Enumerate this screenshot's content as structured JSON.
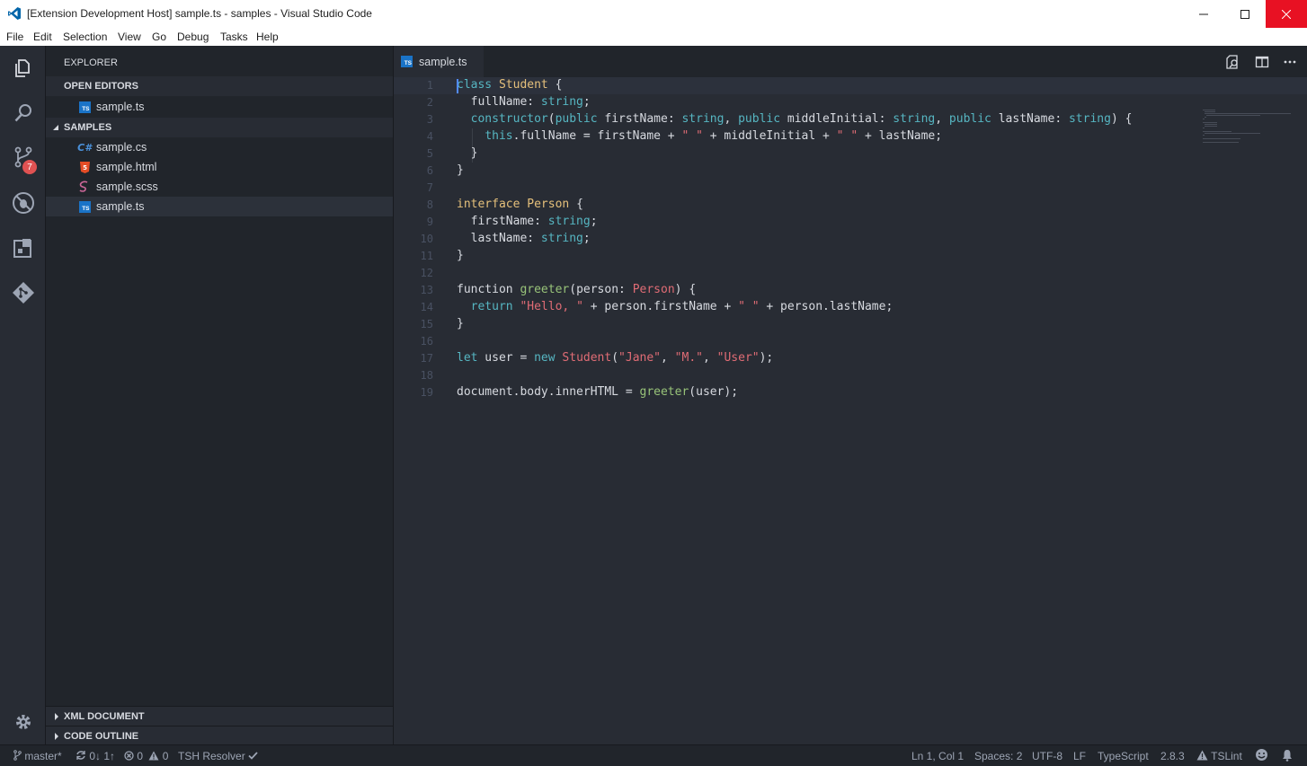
{
  "window": {
    "title": "[Extension Development Host] sample.ts - samples - Visual Studio Code",
    "controls": [
      "minimize",
      "maximize",
      "close"
    ]
  },
  "menu": [
    "File",
    "Edit",
    "Selection",
    "View",
    "Go",
    "Debug",
    "Tasks",
    "Help"
  ],
  "activity_bar": {
    "items": [
      "explorer-icon",
      "search-icon",
      "source-control-icon",
      "debug-icon",
      "extensions-icon",
      "git-icon"
    ],
    "scm_badge": "7",
    "bottom": "gear-icon"
  },
  "sidebar": {
    "title": "EXPLORER",
    "open_editors": {
      "header": "OPEN EDITORS",
      "files": [
        {
          "name": "sample.ts",
          "icon": "ts"
        }
      ]
    },
    "samples": {
      "header": "SAMPLES",
      "files": [
        {
          "name": "sample.cs",
          "icon": "csharp"
        },
        {
          "name": "sample.html",
          "icon": "html"
        },
        {
          "name": "sample.scss",
          "icon": "scss"
        },
        {
          "name": "sample.ts",
          "icon": "ts"
        }
      ]
    },
    "xml_document": "XML DOCUMENT",
    "code_outline": "CODE OUTLINE"
  },
  "editor": {
    "tab": "sample.ts",
    "line_numbers": [
      "1",
      "2",
      "3",
      "4",
      "5",
      "6",
      "7",
      "8",
      "9",
      "10",
      "11",
      "12",
      "13",
      "14",
      "15",
      "16",
      "17",
      "18",
      "19"
    ]
  },
  "status": {
    "branch": "master*",
    "sync": "0↓ 1↑",
    "errors": "0",
    "warnings": "0",
    "resolver": "TSH Resolver",
    "position": "Ln 1, Col 1",
    "spaces": "Spaces: 2",
    "encoding": "UTF-8",
    "eol": "LF",
    "language": "TypeScript",
    "version": "2.8.3",
    "lint": "TSLint"
  },
  "colors": {
    "accent": "#1a73c7",
    "close": "#e81123",
    "badge": "#e05252"
  }
}
